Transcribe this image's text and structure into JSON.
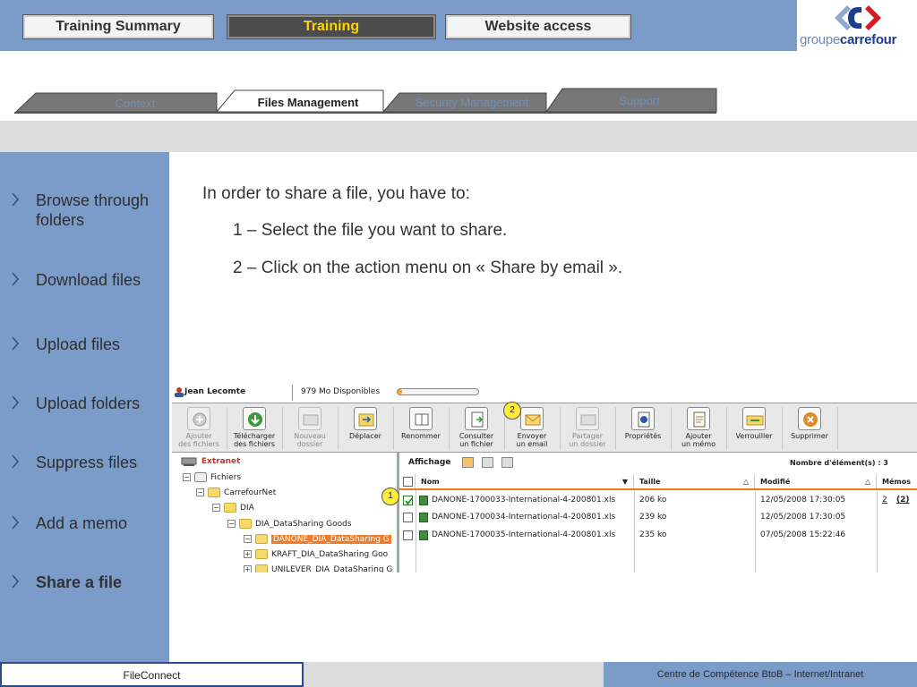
{
  "topnav": {
    "tabs": [
      {
        "label": "Training Summary",
        "active": false
      },
      {
        "label": "Training",
        "active": true
      },
      {
        "label": "Website access",
        "active": false
      }
    ],
    "logo": {
      "prefix": "groupe",
      "brand": "carrefour"
    }
  },
  "subnav": {
    "tabs": [
      {
        "label": "Context",
        "active": false
      },
      {
        "label": "Files Management",
        "active": true
      },
      {
        "label": "Security Management",
        "active": false
      },
      {
        "label": "Support",
        "active": false
      }
    ]
  },
  "sidebar": {
    "items": [
      {
        "label": "Browse through folders"
      },
      {
        "label": "Download files"
      },
      {
        "label": "Upload files"
      },
      {
        "label": "Upload folders"
      },
      {
        "label": "Suppress files"
      },
      {
        "label": "Add a memo"
      },
      {
        "label": "Share a file",
        "current": true
      }
    ]
  },
  "content": {
    "intro": "In order to share a file, you have to:",
    "step1": "1 – Select the file you want to share.",
    "step2": "2 – Click on the action menu on « Share by email »."
  },
  "app": {
    "user": "Jean Lecomte",
    "quota": "979 Mo Disponibles",
    "toolbar": [
      {
        "line1": "Ajouter",
        "line2": "des fichiers",
        "disabled": true
      },
      {
        "line1": "Télécharger",
        "line2": "des fichiers",
        "disabled": false
      },
      {
        "line1": "Nouveau",
        "line2": "dossier",
        "disabled": true
      },
      {
        "line1": "Déplacer",
        "line2": "",
        "disabled": false
      },
      {
        "line1": "Renommer",
        "line2": "",
        "disabled": false
      },
      {
        "line1": "Consulter",
        "line2": "un fichier",
        "disabled": false
      },
      {
        "line1": "Envoyer",
        "line2": "un email",
        "disabled": false
      },
      {
        "line1": "Partager",
        "line2": "un dossier",
        "disabled": true
      },
      {
        "line1": "Propriétés",
        "line2": "",
        "disabled": false
      },
      {
        "line1": "Ajouter",
        "line2": "un mémo",
        "disabled": false
      },
      {
        "line1": "Verrouiller",
        "line2": "",
        "disabled": false
      },
      {
        "line1": "Supprimer",
        "line2": "",
        "disabled": false
      }
    ],
    "tree": {
      "root": "Extranet",
      "nodes": [
        {
          "label": "Fichiers"
        },
        {
          "label": "CarrefourNet"
        },
        {
          "label": "DIA"
        },
        {
          "label": "DIA_DataSharing Goods"
        },
        {
          "label": "DANONE_DIA_DataSharing G"
        },
        {
          "label": "KRAFT_DIA_DataSharing Goo"
        },
        {
          "label": "UNILEVER_DIA_DataSharing G"
        }
      ]
    },
    "list": {
      "display_label": "Affichage",
      "count_label": "Nombre d'élément(s) : 3",
      "columns": {
        "name": "Nom",
        "size": "Taille",
        "modified": "Modifié",
        "memos": "Mémos"
      },
      "rows": [
        {
          "name": "DANONE-1700033-International-4-200801.xls",
          "size": "206 ko",
          "modified": "12/05/2008 17:30:05",
          "memo_count": "2",
          "memo_link": "(2)",
          "checked": true
        },
        {
          "name": "DANONE-1700034-International-4-200801.xls",
          "size": "239 ko",
          "modified": "12/05/2008 17:30:05",
          "memo_count": "",
          "memo_link": "",
          "checked": false
        },
        {
          "name": "DANONE-1700035-International-4-200801.xls",
          "size": "235 ko",
          "modified": "07/05/2008 15:22:46",
          "memo_count": "",
          "memo_link": "",
          "checked": false
        }
      ]
    },
    "callouts": [
      "1",
      "2"
    ]
  },
  "footer": {
    "left": "FileConnect",
    "right": "Centre de Compétence BtoB – Internet/Intranet"
  },
  "colors": {
    "brand_blue": "#7b9cc9",
    "active_tab_text": "#ffd400",
    "selection_orange": "#f07c2a"
  }
}
